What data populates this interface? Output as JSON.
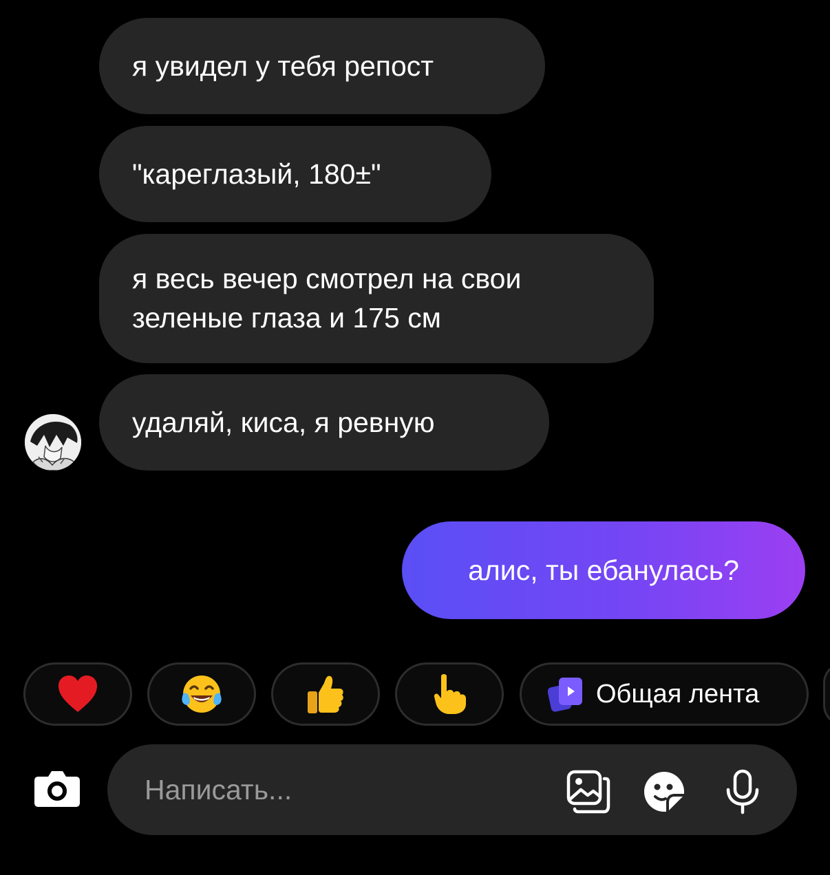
{
  "messages": {
    "incoming": [
      {
        "text": "я увидел у тебя репост"
      },
      {
        "text": "\"кареглазый, 180±\""
      },
      {
        "lines": [
          "я весь вечер смотрел на свои",
          "зеленые глаза и 175 см"
        ]
      },
      {
        "text": "удаляй, киса, я ревную"
      }
    ],
    "outgoing": [
      {
        "text": "алис, ты ебанулась?"
      }
    ]
  },
  "reactions": [
    {
      "icon": "heart-emoji",
      "glyph": "❤️"
    },
    {
      "icon": "laughing-tears-emoji",
      "glyph": "😂"
    },
    {
      "icon": "thumbs-up-emoji",
      "glyph": "👍"
    },
    {
      "icon": "pointing-hand-emoji",
      "glyph": "👆"
    }
  ],
  "feed_chip": {
    "icon": "feed-icon",
    "label": "Общая лента"
  },
  "composer": {
    "placeholder": "Написать...",
    "icons": [
      "camera-icon",
      "gallery-icon",
      "sticker-icon",
      "microphone-icon"
    ]
  },
  "colors": {
    "background": "#000000",
    "incoming_bubble": "#262626",
    "outgoing_gradient_start": "#5a4ff5",
    "outgoing_gradient_end": "#9b3ff2",
    "accent": "#7b5cff"
  }
}
